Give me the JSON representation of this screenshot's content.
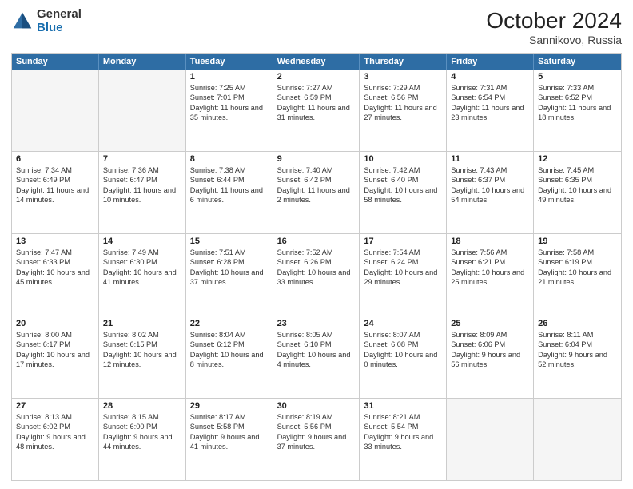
{
  "header": {
    "logo_general": "General",
    "logo_blue": "Blue",
    "month": "October 2024",
    "location": "Sannikovo, Russia"
  },
  "weekdays": [
    "Sunday",
    "Monday",
    "Tuesday",
    "Wednesday",
    "Thursday",
    "Friday",
    "Saturday"
  ],
  "rows": [
    [
      {
        "day": "",
        "empty": true
      },
      {
        "day": "",
        "empty": true
      },
      {
        "day": "1",
        "sunrise": "Sunrise: 7:25 AM",
        "sunset": "Sunset: 7:01 PM",
        "daylight": "Daylight: 11 hours and 35 minutes."
      },
      {
        "day": "2",
        "sunrise": "Sunrise: 7:27 AM",
        "sunset": "Sunset: 6:59 PM",
        "daylight": "Daylight: 11 hours and 31 minutes."
      },
      {
        "day": "3",
        "sunrise": "Sunrise: 7:29 AM",
        "sunset": "Sunset: 6:56 PM",
        "daylight": "Daylight: 11 hours and 27 minutes."
      },
      {
        "day": "4",
        "sunrise": "Sunrise: 7:31 AM",
        "sunset": "Sunset: 6:54 PM",
        "daylight": "Daylight: 11 hours and 23 minutes."
      },
      {
        "day": "5",
        "sunrise": "Sunrise: 7:33 AM",
        "sunset": "Sunset: 6:52 PM",
        "daylight": "Daylight: 11 hours and 18 minutes."
      }
    ],
    [
      {
        "day": "6",
        "sunrise": "Sunrise: 7:34 AM",
        "sunset": "Sunset: 6:49 PM",
        "daylight": "Daylight: 11 hours and 14 minutes."
      },
      {
        "day": "7",
        "sunrise": "Sunrise: 7:36 AM",
        "sunset": "Sunset: 6:47 PM",
        "daylight": "Daylight: 11 hours and 10 minutes."
      },
      {
        "day": "8",
        "sunrise": "Sunrise: 7:38 AM",
        "sunset": "Sunset: 6:44 PM",
        "daylight": "Daylight: 11 hours and 6 minutes."
      },
      {
        "day": "9",
        "sunrise": "Sunrise: 7:40 AM",
        "sunset": "Sunset: 6:42 PM",
        "daylight": "Daylight: 11 hours and 2 minutes."
      },
      {
        "day": "10",
        "sunrise": "Sunrise: 7:42 AM",
        "sunset": "Sunset: 6:40 PM",
        "daylight": "Daylight: 10 hours and 58 minutes."
      },
      {
        "day": "11",
        "sunrise": "Sunrise: 7:43 AM",
        "sunset": "Sunset: 6:37 PM",
        "daylight": "Daylight: 10 hours and 54 minutes."
      },
      {
        "day": "12",
        "sunrise": "Sunrise: 7:45 AM",
        "sunset": "Sunset: 6:35 PM",
        "daylight": "Daylight: 10 hours and 49 minutes."
      }
    ],
    [
      {
        "day": "13",
        "sunrise": "Sunrise: 7:47 AM",
        "sunset": "Sunset: 6:33 PM",
        "daylight": "Daylight: 10 hours and 45 minutes."
      },
      {
        "day": "14",
        "sunrise": "Sunrise: 7:49 AM",
        "sunset": "Sunset: 6:30 PM",
        "daylight": "Daylight: 10 hours and 41 minutes."
      },
      {
        "day": "15",
        "sunrise": "Sunrise: 7:51 AM",
        "sunset": "Sunset: 6:28 PM",
        "daylight": "Daylight: 10 hours and 37 minutes."
      },
      {
        "day": "16",
        "sunrise": "Sunrise: 7:52 AM",
        "sunset": "Sunset: 6:26 PM",
        "daylight": "Daylight: 10 hours and 33 minutes."
      },
      {
        "day": "17",
        "sunrise": "Sunrise: 7:54 AM",
        "sunset": "Sunset: 6:24 PM",
        "daylight": "Daylight: 10 hours and 29 minutes."
      },
      {
        "day": "18",
        "sunrise": "Sunrise: 7:56 AM",
        "sunset": "Sunset: 6:21 PM",
        "daylight": "Daylight: 10 hours and 25 minutes."
      },
      {
        "day": "19",
        "sunrise": "Sunrise: 7:58 AM",
        "sunset": "Sunset: 6:19 PM",
        "daylight": "Daylight: 10 hours and 21 minutes."
      }
    ],
    [
      {
        "day": "20",
        "sunrise": "Sunrise: 8:00 AM",
        "sunset": "Sunset: 6:17 PM",
        "daylight": "Daylight: 10 hours and 17 minutes."
      },
      {
        "day": "21",
        "sunrise": "Sunrise: 8:02 AM",
        "sunset": "Sunset: 6:15 PM",
        "daylight": "Daylight: 10 hours and 12 minutes."
      },
      {
        "day": "22",
        "sunrise": "Sunrise: 8:04 AM",
        "sunset": "Sunset: 6:12 PM",
        "daylight": "Daylight: 10 hours and 8 minutes."
      },
      {
        "day": "23",
        "sunrise": "Sunrise: 8:05 AM",
        "sunset": "Sunset: 6:10 PM",
        "daylight": "Daylight: 10 hours and 4 minutes."
      },
      {
        "day": "24",
        "sunrise": "Sunrise: 8:07 AM",
        "sunset": "Sunset: 6:08 PM",
        "daylight": "Daylight: 10 hours and 0 minutes."
      },
      {
        "day": "25",
        "sunrise": "Sunrise: 8:09 AM",
        "sunset": "Sunset: 6:06 PM",
        "daylight": "Daylight: 9 hours and 56 minutes."
      },
      {
        "day": "26",
        "sunrise": "Sunrise: 8:11 AM",
        "sunset": "Sunset: 6:04 PM",
        "daylight": "Daylight: 9 hours and 52 minutes."
      }
    ],
    [
      {
        "day": "27",
        "sunrise": "Sunrise: 8:13 AM",
        "sunset": "Sunset: 6:02 PM",
        "daylight": "Daylight: 9 hours and 48 minutes."
      },
      {
        "day": "28",
        "sunrise": "Sunrise: 8:15 AM",
        "sunset": "Sunset: 6:00 PM",
        "daylight": "Daylight: 9 hours and 44 minutes."
      },
      {
        "day": "29",
        "sunrise": "Sunrise: 8:17 AM",
        "sunset": "Sunset: 5:58 PM",
        "daylight": "Daylight: 9 hours and 41 minutes."
      },
      {
        "day": "30",
        "sunrise": "Sunrise: 8:19 AM",
        "sunset": "Sunset: 5:56 PM",
        "daylight": "Daylight: 9 hours and 37 minutes."
      },
      {
        "day": "31",
        "sunrise": "Sunrise: 8:21 AM",
        "sunset": "Sunset: 5:54 PM",
        "daylight": "Daylight: 9 hours and 33 minutes."
      },
      {
        "day": "",
        "empty": true
      },
      {
        "day": "",
        "empty": true
      }
    ]
  ]
}
